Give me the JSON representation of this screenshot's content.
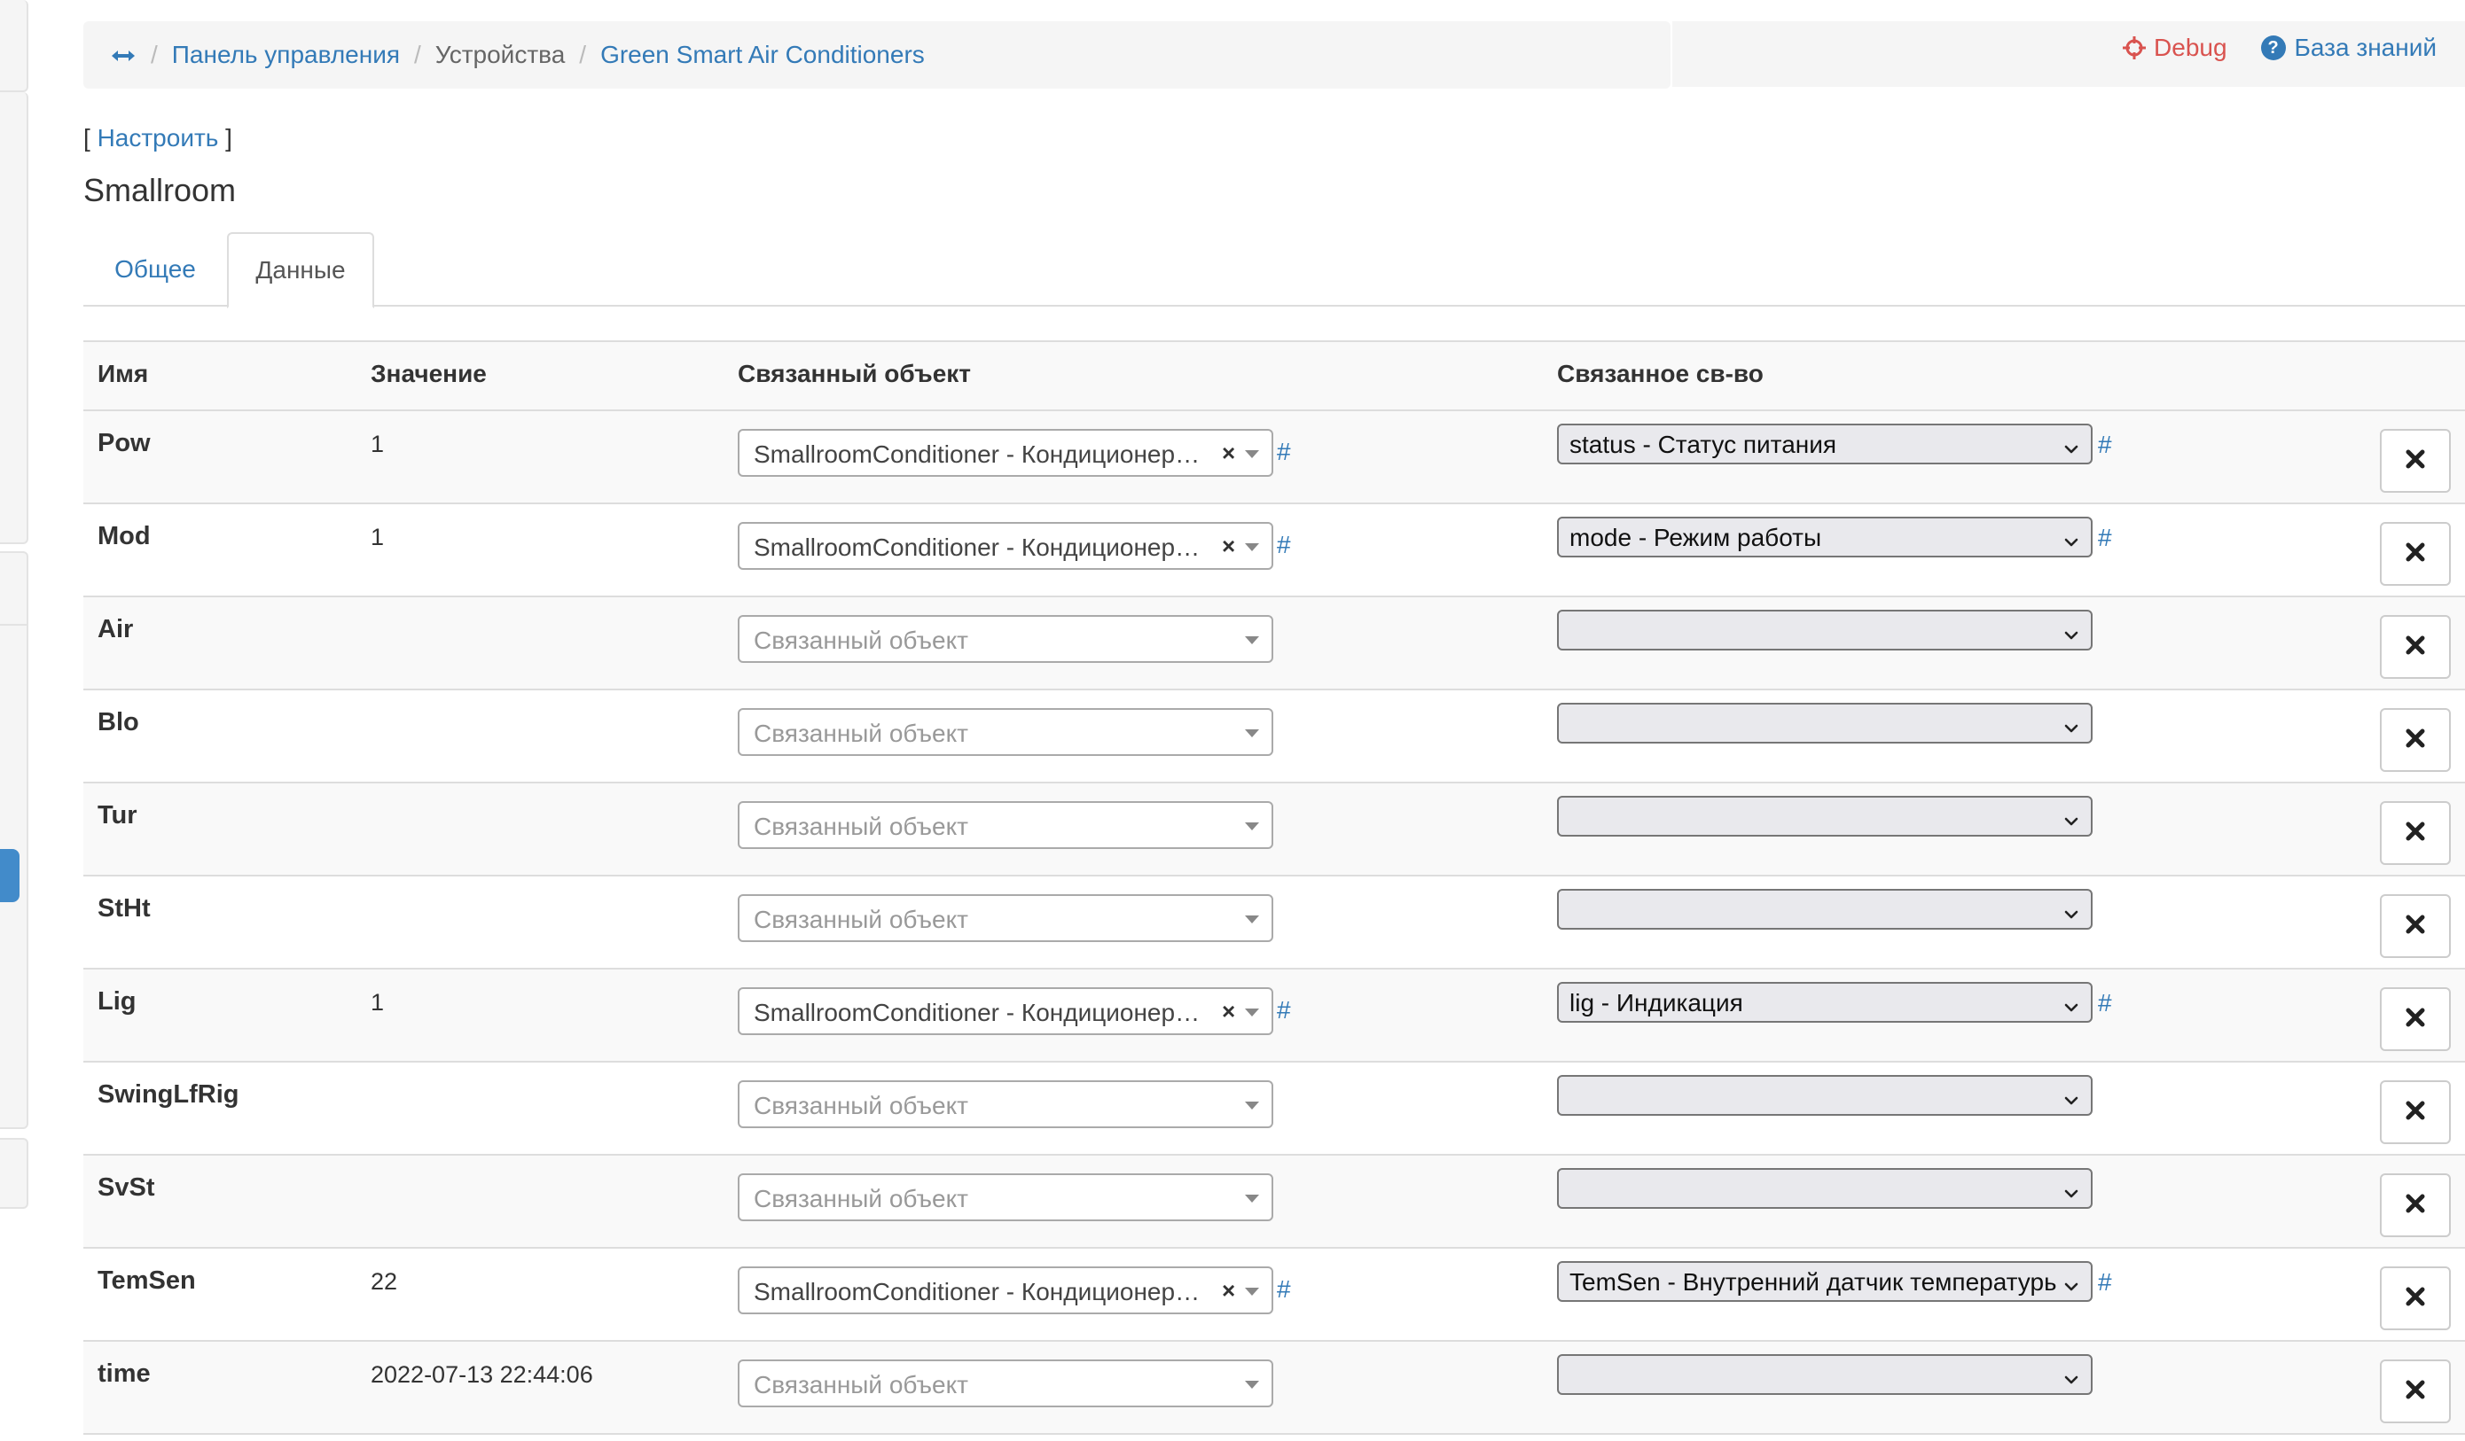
{
  "breadcrumb": {
    "items": [
      "Панель управления",
      "Устройства",
      "Green Smart Air Conditioners"
    ],
    "separator": "/"
  },
  "top_links": {
    "debug": "Debug",
    "knowledge_base": "База знаний"
  },
  "configure": {
    "open_bracket": "[",
    "label": "Настроить",
    "close_bracket": "]"
  },
  "page_title": "Smallroom",
  "tabs": [
    {
      "label": "Общее",
      "active": false
    },
    {
      "label": "Данные",
      "active": true
    }
  ],
  "table": {
    "headers": [
      "Имя",
      "Значение",
      "Связанный объект",
      "Связанное св-во"
    ],
    "object_placeholder": "Связанный объект",
    "hash": "#",
    "clear_glyph": "×",
    "rows": [
      {
        "name": "Pow",
        "value": "1",
        "object": "SmallroomConditioner - Кондиционер Малой комнаты",
        "property": "status - Статус питания"
      },
      {
        "name": "Mod",
        "value": "1",
        "object": "SmallroomConditioner - Кондиционер Малой комнаты",
        "property": "mode - Режим работы"
      },
      {
        "name": "Air",
        "value": "",
        "object": "",
        "property": ""
      },
      {
        "name": "Blo",
        "value": "",
        "object": "",
        "property": ""
      },
      {
        "name": "Tur",
        "value": "",
        "object": "",
        "property": ""
      },
      {
        "name": "StHt",
        "value": "",
        "object": "",
        "property": ""
      },
      {
        "name": "Lig",
        "value": "1",
        "object": "SmallroomConditioner - Кондиционер Малой комнаты",
        "property": "lig - Индикация"
      },
      {
        "name": "SwingLfRig",
        "value": "",
        "object": "",
        "property": ""
      },
      {
        "name": "SvSt",
        "value": "",
        "object": "",
        "property": ""
      },
      {
        "name": "TemSen",
        "value": "22",
        "object": "SmallroomConditioner - Кондиционер Малой комнаты",
        "property": "TemSen - Внутренний датчик температуры"
      },
      {
        "name": "time",
        "value": "2022-07-13 22:44:06",
        "object": "",
        "property": ""
      }
    ]
  },
  "colors": {
    "link": "#337ab7",
    "debug": "#d9534f",
    "active_sidebar": "#428bca"
  },
  "icons": {
    "breadcrumb_toggle": "arrows-horizontal-icon",
    "debug": "crosshair-icon",
    "knowledge_base": "question-circle-icon",
    "delete": "close-icon",
    "select_caret": "caret-down-icon",
    "property_chevron": "chevron-down-icon"
  }
}
